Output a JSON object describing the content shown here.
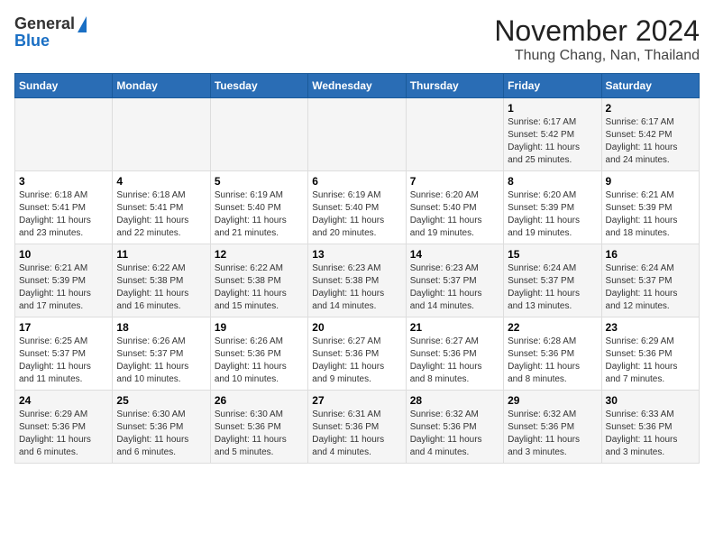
{
  "header": {
    "logo_general": "General",
    "logo_blue": "Blue",
    "month_title": "November 2024",
    "location": "Thung Chang, Nan, Thailand"
  },
  "calendar": {
    "headers": [
      "Sunday",
      "Monday",
      "Tuesday",
      "Wednesday",
      "Thursday",
      "Friday",
      "Saturday"
    ],
    "weeks": [
      [
        {
          "day": "",
          "info": ""
        },
        {
          "day": "",
          "info": ""
        },
        {
          "day": "",
          "info": ""
        },
        {
          "day": "",
          "info": ""
        },
        {
          "day": "",
          "info": ""
        },
        {
          "day": "1",
          "info": "Sunrise: 6:17 AM\nSunset: 5:42 PM\nDaylight: 11 hours\nand 25 minutes."
        },
        {
          "day": "2",
          "info": "Sunrise: 6:17 AM\nSunset: 5:42 PM\nDaylight: 11 hours\nand 24 minutes."
        }
      ],
      [
        {
          "day": "3",
          "info": "Sunrise: 6:18 AM\nSunset: 5:41 PM\nDaylight: 11 hours\nand 23 minutes."
        },
        {
          "day": "4",
          "info": "Sunrise: 6:18 AM\nSunset: 5:41 PM\nDaylight: 11 hours\nand 22 minutes."
        },
        {
          "day": "5",
          "info": "Sunrise: 6:19 AM\nSunset: 5:40 PM\nDaylight: 11 hours\nand 21 minutes."
        },
        {
          "day": "6",
          "info": "Sunrise: 6:19 AM\nSunset: 5:40 PM\nDaylight: 11 hours\nand 20 minutes."
        },
        {
          "day": "7",
          "info": "Sunrise: 6:20 AM\nSunset: 5:40 PM\nDaylight: 11 hours\nand 19 minutes."
        },
        {
          "day": "8",
          "info": "Sunrise: 6:20 AM\nSunset: 5:39 PM\nDaylight: 11 hours\nand 19 minutes."
        },
        {
          "day": "9",
          "info": "Sunrise: 6:21 AM\nSunset: 5:39 PM\nDaylight: 11 hours\nand 18 minutes."
        }
      ],
      [
        {
          "day": "10",
          "info": "Sunrise: 6:21 AM\nSunset: 5:39 PM\nDaylight: 11 hours\nand 17 minutes."
        },
        {
          "day": "11",
          "info": "Sunrise: 6:22 AM\nSunset: 5:38 PM\nDaylight: 11 hours\nand 16 minutes."
        },
        {
          "day": "12",
          "info": "Sunrise: 6:22 AM\nSunset: 5:38 PM\nDaylight: 11 hours\nand 15 minutes."
        },
        {
          "day": "13",
          "info": "Sunrise: 6:23 AM\nSunset: 5:38 PM\nDaylight: 11 hours\nand 14 minutes."
        },
        {
          "day": "14",
          "info": "Sunrise: 6:23 AM\nSunset: 5:37 PM\nDaylight: 11 hours\nand 14 minutes."
        },
        {
          "day": "15",
          "info": "Sunrise: 6:24 AM\nSunset: 5:37 PM\nDaylight: 11 hours\nand 13 minutes."
        },
        {
          "day": "16",
          "info": "Sunrise: 6:24 AM\nSunset: 5:37 PM\nDaylight: 11 hours\nand 12 minutes."
        }
      ],
      [
        {
          "day": "17",
          "info": "Sunrise: 6:25 AM\nSunset: 5:37 PM\nDaylight: 11 hours\nand 11 minutes."
        },
        {
          "day": "18",
          "info": "Sunrise: 6:26 AM\nSunset: 5:37 PM\nDaylight: 11 hours\nand 10 minutes."
        },
        {
          "day": "19",
          "info": "Sunrise: 6:26 AM\nSunset: 5:36 PM\nDaylight: 11 hours\nand 10 minutes."
        },
        {
          "day": "20",
          "info": "Sunrise: 6:27 AM\nSunset: 5:36 PM\nDaylight: 11 hours\nand 9 minutes."
        },
        {
          "day": "21",
          "info": "Sunrise: 6:27 AM\nSunset: 5:36 PM\nDaylight: 11 hours\nand 8 minutes."
        },
        {
          "day": "22",
          "info": "Sunrise: 6:28 AM\nSunset: 5:36 PM\nDaylight: 11 hours\nand 8 minutes."
        },
        {
          "day": "23",
          "info": "Sunrise: 6:29 AM\nSunset: 5:36 PM\nDaylight: 11 hours\nand 7 minutes."
        }
      ],
      [
        {
          "day": "24",
          "info": "Sunrise: 6:29 AM\nSunset: 5:36 PM\nDaylight: 11 hours\nand 6 minutes."
        },
        {
          "day": "25",
          "info": "Sunrise: 6:30 AM\nSunset: 5:36 PM\nDaylight: 11 hours\nand 6 minutes."
        },
        {
          "day": "26",
          "info": "Sunrise: 6:30 AM\nSunset: 5:36 PM\nDaylight: 11 hours\nand 5 minutes."
        },
        {
          "day": "27",
          "info": "Sunrise: 6:31 AM\nSunset: 5:36 PM\nDaylight: 11 hours\nand 4 minutes."
        },
        {
          "day": "28",
          "info": "Sunrise: 6:32 AM\nSunset: 5:36 PM\nDaylight: 11 hours\nand 4 minutes."
        },
        {
          "day": "29",
          "info": "Sunrise: 6:32 AM\nSunset: 5:36 PM\nDaylight: 11 hours\nand 3 minutes."
        },
        {
          "day": "30",
          "info": "Sunrise: 6:33 AM\nSunset: 5:36 PM\nDaylight: 11 hours\nand 3 minutes."
        }
      ]
    ]
  }
}
